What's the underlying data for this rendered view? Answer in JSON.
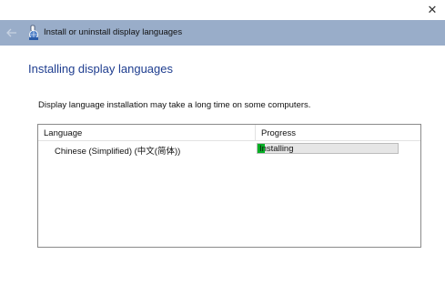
{
  "window": {
    "close_glyph": "✕"
  },
  "header": {
    "back_icon": "back-arrow-icon",
    "app_icon": "language-globe-icon",
    "title": "Install or uninstall display languages",
    "band_color": "#99adc9"
  },
  "main": {
    "heading": "Installing display languages",
    "heading_color": "#1e3d8f",
    "description": "Display language installation may take a long time on some computers."
  },
  "list": {
    "columns": [
      "Language",
      "Progress"
    ],
    "rows": [
      {
        "language": "Chinese (Simplified) (中文(简体))",
        "status": "Installing",
        "progress_fraction": 0.05,
        "progress_color": "#06b025"
      }
    ]
  }
}
